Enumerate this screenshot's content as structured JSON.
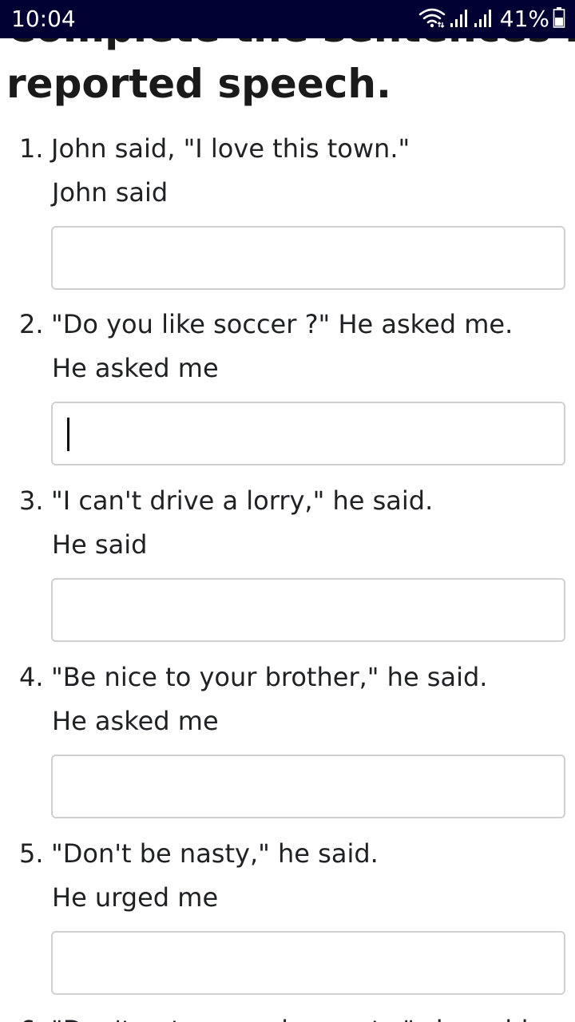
{
  "status_bar": {
    "time": "10:04",
    "battery": "41%",
    "icons": [
      "wifi-icon",
      "signal-icon",
      "signal-icon",
      "battery-icon"
    ]
  },
  "page": {
    "heading_line1": "Complete the sentences in",
    "heading_line2": "reported speech."
  },
  "questions": [
    {
      "number": "1.",
      "sentence": "John said, \"I love this town.\"",
      "prompt": "John said",
      "answer": ""
    },
    {
      "number": "2.",
      "sentence": "\"Do you like soccer ?\" He asked me.",
      "prompt": "He asked me",
      "answer": ""
    },
    {
      "number": "3.",
      "sentence": "\"I can't drive a lorry,\" he said.",
      "prompt": "He said",
      "answer": ""
    },
    {
      "number": "4.",
      "sentence": "\"Be nice to your brother,\" he said.",
      "prompt": "He asked me",
      "answer": ""
    },
    {
      "number": "5.",
      "sentence": "\"Don't be nasty,\" he said.",
      "prompt": "He urged me",
      "answer": ""
    },
    {
      "number": "6.",
      "sentence": "\"Don't eat so much sweets,\" she said.",
      "prompt": "",
      "answer": ""
    }
  ],
  "colors": {
    "status_bar_bg": "#000033",
    "input_border": "#d0d0d0",
    "text": "#202124"
  }
}
